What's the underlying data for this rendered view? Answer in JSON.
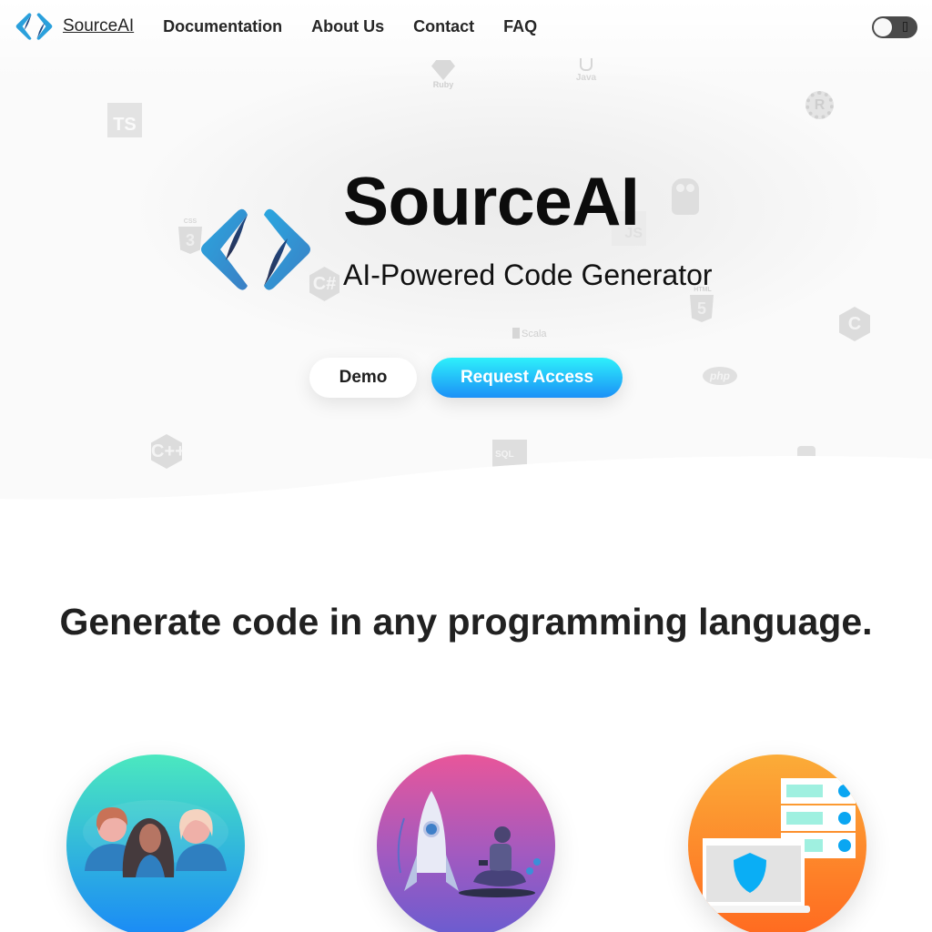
{
  "nav": {
    "brand_name": "SourceAI",
    "brand_logo_icon": "code-brackets-logo",
    "links": [
      {
        "label": "Documentation"
      },
      {
        "label": "About Us"
      },
      {
        "label": "Contact"
      },
      {
        "label": "FAQ"
      }
    ],
    "theme_toggle": {
      "state": "off",
      "icon": "moon-icon"
    }
  },
  "hero": {
    "title": "SourceAI",
    "subtitle": "AI-Powered Code Generator",
    "demo_label": "Demo",
    "request_access_label": "Request Access",
    "background_language_icons": [
      {
        "name": "typescript",
        "text": "TS"
      },
      {
        "name": "ruby",
        "text": "Ruby"
      },
      {
        "name": "java",
        "text": "Java"
      },
      {
        "name": "rust",
        "text": "R"
      },
      {
        "name": "css3",
        "text": "CSS"
      },
      {
        "name": "go",
        "text": ""
      },
      {
        "name": "javascript",
        "text": "JS"
      },
      {
        "name": "csharp",
        "text": "C#"
      },
      {
        "name": "html5",
        "text": "HTML"
      },
      {
        "name": "c",
        "text": "C"
      },
      {
        "name": "scala",
        "text": "Scala"
      },
      {
        "name": "php",
        "text": "php"
      },
      {
        "name": "cpp",
        "text": "C++"
      },
      {
        "name": "sql",
        "text": "SQL"
      },
      {
        "name": "python",
        "text": ""
      }
    ]
  },
  "features": {
    "title": "Generate code in any programming language.",
    "items": [
      {
        "illustration": "team-people-illustration",
        "gradient": [
          "#4be8bf",
          "#1a8af6"
        ]
      },
      {
        "illustration": "rocket-launch-illustration",
        "gradient": [
          "#e8569a",
          "#6a5cd0"
        ]
      },
      {
        "illustration": "secure-server-laptop-illustration",
        "gradient": [
          "#fbac38",
          "#ff6a20"
        ]
      }
    ]
  },
  "colors": {
    "accent_start": "#2ef0fb",
    "accent_end": "#1b90f7",
    "logo_light": "#2aa7e0",
    "logo_dark": "#1d3f78"
  }
}
